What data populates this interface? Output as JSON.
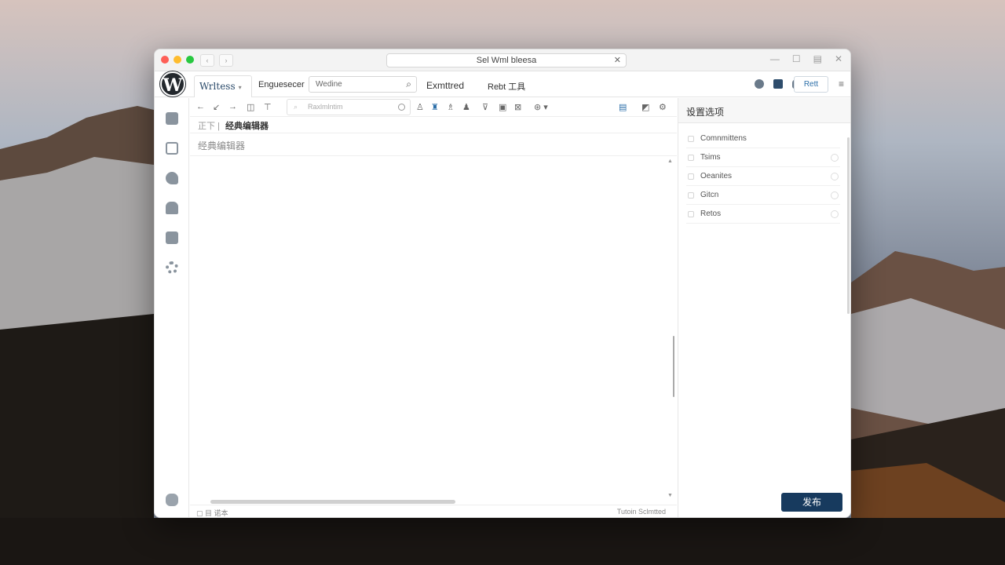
{
  "window": {
    "url_title": "Sel Wml bleesa",
    "colors": {
      "publish": "#173a5e",
      "accent": "#2b6ea8"
    }
  },
  "menubar": {
    "active_tab": "Wrltess",
    "items": [
      "Enguesecer",
      "Wedine",
      "Exmttred",
      "Rebt 工具"
    ],
    "search_placeholder": "Wedine",
    "save_label": "Rett"
  },
  "editor_toolbar": {
    "search_placeholder": "Raxlmlntim"
  },
  "breadcrumb": {
    "root": "正下",
    "current": "经典编辑器"
  },
  "title_field": {
    "placeholder": "经典编辑器"
  },
  "statusbar": {
    "left": "目 诺本",
    "right": "Tutoin Sclmtted"
  },
  "settings_panel": {
    "title": "设置选项",
    "items": [
      "Comnmittens",
      "Tsims",
      "Oeanites",
      "Gitcn",
      "Retos"
    ]
  },
  "publish": {
    "label": "发布"
  }
}
